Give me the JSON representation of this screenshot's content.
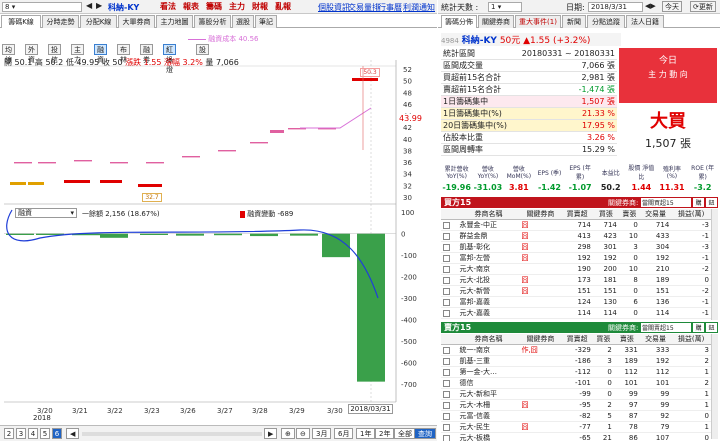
{
  "top": {
    "stock_select": "8",
    "stock_name": "科納-KY",
    "stock_label": "科納-KY",
    "tools": [
      "看法",
      "報表",
      "籌碼",
      "主力",
      "財報",
      "亂報"
    ],
    "links": [
      "個股資訊",
      "交易量排",
      "行事曆",
      "利潤通知"
    ]
  },
  "tabs": [
    "籌碼K線",
    "分時走勢",
    "分配K線",
    "大單券商",
    "主力地圖",
    "籌股分析",
    "選股",
    "筆記"
  ],
  "chart_buttons": [
    "均線",
    "外資",
    "投信",
    "主力",
    "融資",
    "布林",
    "融券",
    "紅綠燈",
    "設"
  ],
  "ohlc": {
    "open": "開 50.1",
    "high": "高 50.2",
    "low": "低 49.95",
    "close": "收 50",
    "change": "漲跌 1.55",
    "pct": "漲幅 3.2%",
    "vol": "量 7,066"
  },
  "legend_cost": "融資成本 40.56",
  "margin_select": "融資",
  "margin_total": "一餘額 2,156 (18.67%)",
  "margin_change": "融資變動 -689",
  "price_label_top": "50.3",
  "price_label_low": "32.7",
  "current_price": "43.99",
  "y_ticks_price": [
    "52",
    "50",
    "48",
    "46",
    "44",
    "42",
    "40",
    "38",
    "36",
    "34",
    "32",
    "30"
  ],
  "y_ticks_margin": [
    "100",
    "0",
    "-100",
    "-200",
    "-300",
    "-400",
    "-500",
    "-600",
    "-700"
  ],
  "x_ticks": [
    "3/20",
    "3/21",
    "3/22",
    "3/23",
    "3/26",
    "3/27",
    "3/28",
    "3/29",
    "3/30"
  ],
  "x_year": "2018",
  "x_cursor": "2018/03/31",
  "bottom": {
    "pages": [
      "2",
      "3",
      "4",
      "5",
      "6"
    ],
    "zoom": [
      "3月",
      "6月",
      "1年",
      "2年",
      "全部",
      "查詢"
    ]
  },
  "right_top": {
    "label_days": "統計天數 :",
    "days": "1",
    "date_label": "日期:",
    "date": "2018/3/31",
    "today_btn": "今天",
    "refresh": "更新"
  },
  "right_tabs": [
    "籌碼分佈",
    "關鍵券商",
    "重大事件(1)",
    "新聞",
    "分點追蹤",
    "法人日籍"
  ],
  "stock_line": {
    "code": "4984",
    "name": "科納-KY",
    "price": "50元",
    "change": "▲1.55 (+3.2%)"
  },
  "stats": {
    "period_label": "統計區間",
    "period": "20180331 ~ 20180331",
    "rows": [
      {
        "label": "區間成交量",
        "value": "7,066 張",
        "style": ""
      },
      {
        "label": "買超前15名合計",
        "value": "2,981 張",
        "style": ""
      },
      {
        "label": "賣超前15名合計",
        "value": "-1,474 張",
        "style": ""
      },
      {
        "label": "1日籌碼集中",
        "value": "1,507 張",
        "style": "pk"
      },
      {
        "label": "1日籌碼集中(%)",
        "value": "21.33 %",
        "style": "yl"
      },
      {
        "label": "20日籌碼集中(%)",
        "value": "17.95 %",
        "style": "yl"
      },
      {
        "label": "佔股本比重",
        "value": "3.26 %",
        "style": ""
      },
      {
        "label": "區間周轉率",
        "value": "15.29 %",
        "style": ""
      }
    ]
  },
  "today_box": {
    "line1": "今日",
    "line2": "主 力 動 向",
    "verdict": "大買",
    "amount": "1,507 張"
  },
  "fin": {
    "headers": [
      "累計營收 YoY(%)",
      "營收 YoY(%)",
      "營收 MoM(%)",
      "EPS (季)",
      "EPS (年累)",
      "本益比",
      "股價 淨值比",
      "殖利率 (%)",
      "ROE (年累)"
    ],
    "values": [
      "-19.96",
      "-31.03",
      "3.81",
      "-1.42",
      "-1.07",
      "50.2",
      "1.44",
      "11.31",
      "-3.2"
    ]
  },
  "buy": {
    "title": "買方15",
    "filter_label": "關鍵券商:",
    "filter": "當關買超15",
    "btn1": "購",
    "btn2": "鈕",
    "headers": [
      "券商名稱",
      "關鍵券商",
      "買賣超",
      "買張",
      "賣張",
      "交易量",
      "損益(萬)"
    ],
    "rows": [
      [
        "永豐金-中正",
        "囧",
        "714",
        "714",
        "0",
        "714",
        "-3"
      ],
      [
        "群益金鼎",
        "囧",
        "413",
        "423",
        "10",
        "433",
        "-1"
      ],
      [
        "凱基-彰化",
        "囧",
        "298",
        "301",
        "3",
        "304",
        "-3"
      ],
      [
        "富邦-左營",
        "囧",
        "192",
        "192",
        "0",
        "192",
        "-1"
      ],
      [
        "元大-南京",
        "",
        "190",
        "200",
        "10",
        "210",
        "-2"
      ],
      [
        "元大-北投",
        "囧",
        "173",
        "181",
        "8",
        "189",
        "0"
      ],
      [
        "元大-新營",
        "囧",
        "151",
        "151",
        "0",
        "151",
        "-2"
      ],
      [
        "富邦-嘉義",
        "",
        "124",
        "130",
        "6",
        "136",
        "-1"
      ],
      [
        "元大-嘉義",
        "",
        "114",
        "114",
        "0",
        "114",
        "-1"
      ]
    ]
  },
  "sell": {
    "title": "賣方15",
    "filter_label": "關鍵券商:",
    "filter": "當關賣超15",
    "btn1": "購",
    "btn2": "鈕",
    "headers": [
      "券商名稱",
      "關鍵券商",
      "買賣超",
      "買張",
      "賣張",
      "交易量",
      "損益(萬)"
    ],
    "rows": [
      [
        "統一-南京",
        "作,囧",
        "-329",
        "2",
        "331",
        "333",
        "3"
      ],
      [
        "凱基-三重",
        "",
        "-186",
        "3",
        "189",
        "192",
        "2"
      ],
      [
        "第一金-大…",
        "",
        "-112",
        "0",
        "112",
        "112",
        "1"
      ],
      [
        "德信",
        "",
        "-101",
        "0",
        "101",
        "101",
        "2"
      ],
      [
        "元大-新和平",
        "",
        "-99",
        "0",
        "99",
        "99",
        "1"
      ],
      [
        "元大-木柵",
        "囧",
        "-95",
        "2",
        "97",
        "99",
        "1"
      ],
      [
        "元富-信義",
        "",
        "-82",
        "5",
        "87",
        "92",
        "0"
      ],
      [
        "元大-民生",
        "囧",
        "-77",
        "1",
        "78",
        "79",
        "1"
      ],
      [
        "元大-板橋",
        "",
        "-65",
        "21",
        "86",
        "107",
        "0"
      ]
    ]
  },
  "colors": {
    "accent": "#e8313b",
    "buy_title": "#c0141c",
    "sell_title": "#1e8a3a"
  }
}
